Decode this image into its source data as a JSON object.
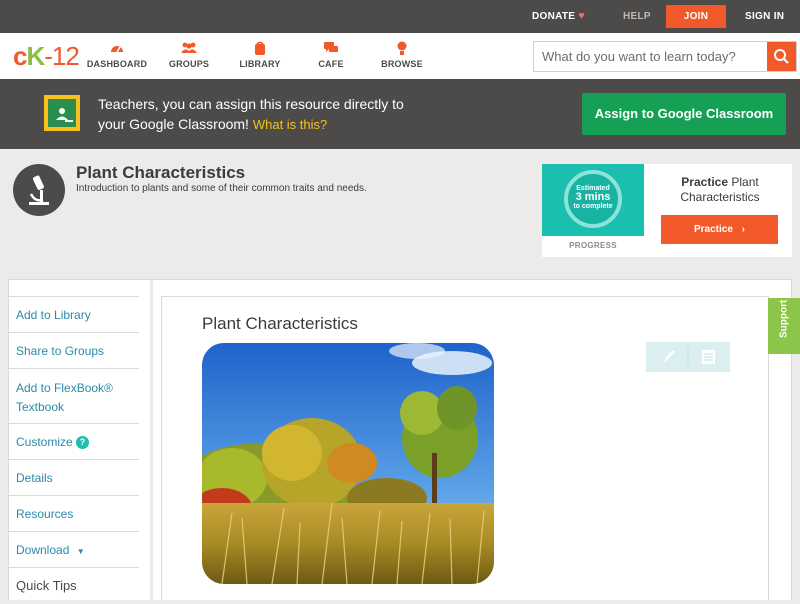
{
  "topbar": {
    "donate": "DONATE",
    "help": "HELP",
    "join": "JOIN",
    "signin": "SIGN IN"
  },
  "logo": {
    "c": "c",
    "k": "K",
    "rest": "-12"
  },
  "nav": [
    {
      "label": "DASHBOARD",
      "icon": "dashboard-icon"
    },
    {
      "label": "GROUPS",
      "icon": "groups-icon"
    },
    {
      "label": "LIBRARY",
      "icon": "library-icon"
    },
    {
      "label": "CAFE",
      "icon": "cafe-icon"
    },
    {
      "label": "BROWSE",
      "icon": "browse-icon"
    }
  ],
  "search": {
    "placeholder": "What do you want to learn today?"
  },
  "gc": {
    "line1": "Teachers, you can assign this resource directly to",
    "line2": "your Google Classroom!",
    "what": "What is this?",
    "button": "Assign to Google Classroom"
  },
  "page": {
    "title": "Plant Characteristics",
    "description": "Introduction to plants and some of their common traits and needs."
  },
  "practice": {
    "estimated": "Estimated",
    "mins": "3 mins",
    "complete": "to complete",
    "progress": "PROGRESS",
    "label_bold": "Practice",
    "label_rest": "Plant Characteristics",
    "button": "Practice"
  },
  "sidebar": {
    "items": [
      "Add to Library",
      "Share to Groups",
      "Add to FlexBook® Textbook",
      "Customize",
      "Details",
      "Resources",
      "Download"
    ],
    "quick_tips": "Quick Tips"
  },
  "article": {
    "title": "Plant Characteristics"
  },
  "support": "Support",
  "colors": {
    "brand_orange": "#f1592a",
    "brand_green": "#8bbf3f",
    "classroom_green": "#16a056",
    "link_blue": "#2b8aa8"
  }
}
